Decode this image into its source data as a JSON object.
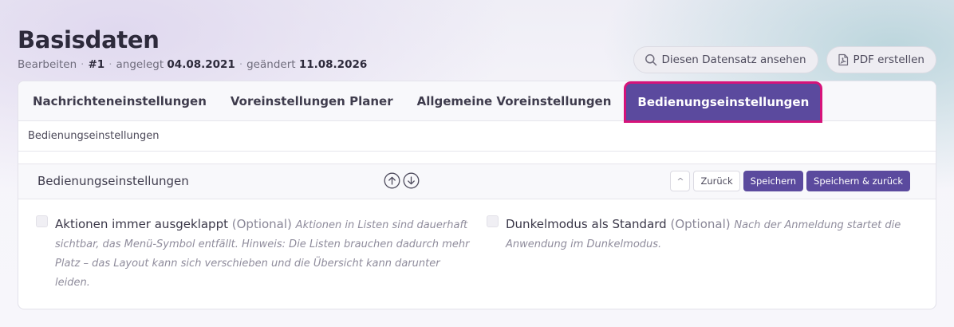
{
  "header": {
    "title": "Basisdaten",
    "meta": {
      "mode": "Bearbeiten",
      "id": "#1",
      "created_label": "angelegt",
      "created_date": "04.08.2021",
      "changed_label": "geändert",
      "changed_date": "11.08.2026",
      "separator": "·"
    },
    "actions": {
      "view_label": "Diesen Datensatz ansehen",
      "view_icon": "search-icon",
      "pdf_label": "PDF erstellen",
      "pdf_icon": "pdf-file-icon"
    }
  },
  "tabs": [
    {
      "label": "Nachrichteneinstellungen",
      "active": false
    },
    {
      "label": "Voreinstellungen Planer",
      "active": false
    },
    {
      "label": "Allgemeine Voreinstellungen",
      "active": false
    },
    {
      "label": "Bedienungseinstellungen",
      "active": true
    }
  ],
  "breadcrumb": "Bedienungseinstellungen",
  "section": {
    "title": "Bedienungseinstellungen",
    "sort_up_icon": "arrow-up-circle-icon",
    "sort_down_icon": "arrow-down-circle-icon",
    "collapse_icon": "chevron-up-icon",
    "collapse_glyph": "^",
    "back_label": "Zurück",
    "save_label": "Speichern",
    "save_back_label": "Speichern & zurück"
  },
  "options": [
    {
      "label": "Aktionen immer ausgeklappt",
      "optional": "(Optional)",
      "description": "Aktionen in Listen sind dauerhaft sichtbar, das Menü-Symbol entfällt. Hinweis: Die Listen brauchen dadurch mehr Platz – das Layout kann sich verschieben und die Übersicht kann darunter leiden.",
      "checked": false
    },
    {
      "label": "Dunkelmodus als Standard",
      "optional": "(Optional)",
      "description": "Nach der Anmeldung startet die Anwendung im Dunkelmodus.",
      "checked": false
    }
  ],
  "colors": {
    "accent": "#5b4a9e",
    "active_tab_outline": "#d6137a"
  }
}
